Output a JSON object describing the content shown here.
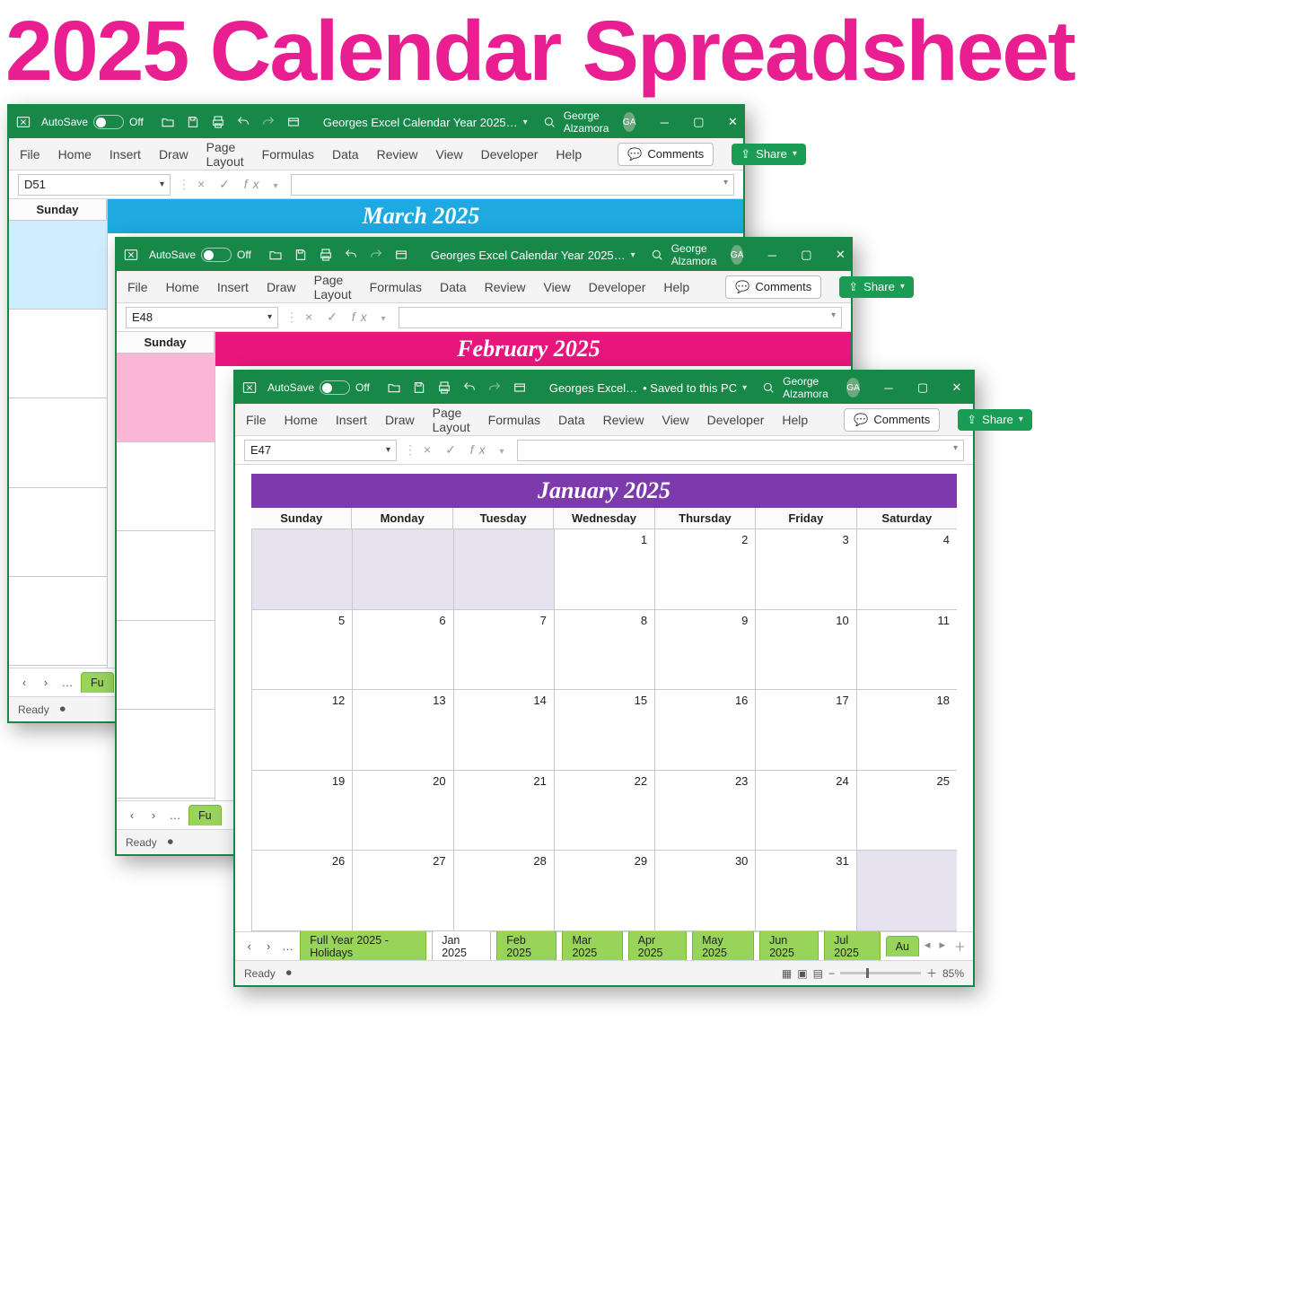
{
  "page_title": "2025 Calendar Spreadsheet",
  "user": {
    "name": "George Alzamora",
    "initials": "GA"
  },
  "autosave_label": "AutoSave",
  "autosave_state": "Off",
  "ribbon_tabs": [
    "File",
    "Home",
    "Insert",
    "Draw",
    "Page Layout",
    "Formulas",
    "Data",
    "Review",
    "View",
    "Developer",
    "Help"
  ],
  "comments_label": "Comments",
  "share_label": "Share",
  "status_ready": "Ready",
  "zoom_percent": "85%",
  "day_headers": [
    "Sunday",
    "Monday",
    "Tuesday",
    "Wednesday",
    "Thursday",
    "Friday",
    "Saturday"
  ],
  "win1": {
    "doc_title": "Georges Excel Calendar Year 2025…",
    "name_box": "D51",
    "month_title": "March 2025",
    "band_class": "band-blue",
    "strip_header": "Sunday",
    "strip_first_bg": "#d0ecff",
    "tab_stub": "Fu"
  },
  "win2": {
    "doc_title": "Georges Excel Calendar Year 2025…",
    "name_box": "E48",
    "month_title": "February 2025",
    "band_class": "band-pink",
    "strip_header": "Sunday",
    "tab_stub": "Fu"
  },
  "win3": {
    "doc_title": "Georges Excel…",
    "saved_txt": "• Saved to this PC",
    "name_box": "E47",
    "month_title": "January 2025",
    "band_class": "band-purple",
    "tabs": [
      "Full Year 2025 - Holidays",
      "Jan 2025",
      "Feb 2025",
      "Mar 2025",
      "Apr 2025",
      "May 2025",
      "Jun 2025",
      "Jul 2025",
      "Au"
    ],
    "active_tab": "Jan 2025"
  },
  "chart_data": {
    "type": "table",
    "title": "January 2025",
    "columns": [
      "Sunday",
      "Monday",
      "Tuesday",
      "Wednesday",
      "Thursday",
      "Friday",
      "Saturday"
    ],
    "rows": [
      [
        "",
        "",
        "",
        1,
        2,
        3,
        4
      ],
      [
        5,
        6,
        7,
        8,
        9,
        10,
        11
      ],
      [
        12,
        13,
        14,
        15,
        16,
        17,
        18
      ],
      [
        19,
        20,
        21,
        22,
        23,
        24,
        25
      ],
      [
        26,
        27,
        28,
        29,
        30,
        31,
        ""
      ]
    ],
    "leading_blank_cells": 3,
    "trailing_blank_cells": 1
  }
}
